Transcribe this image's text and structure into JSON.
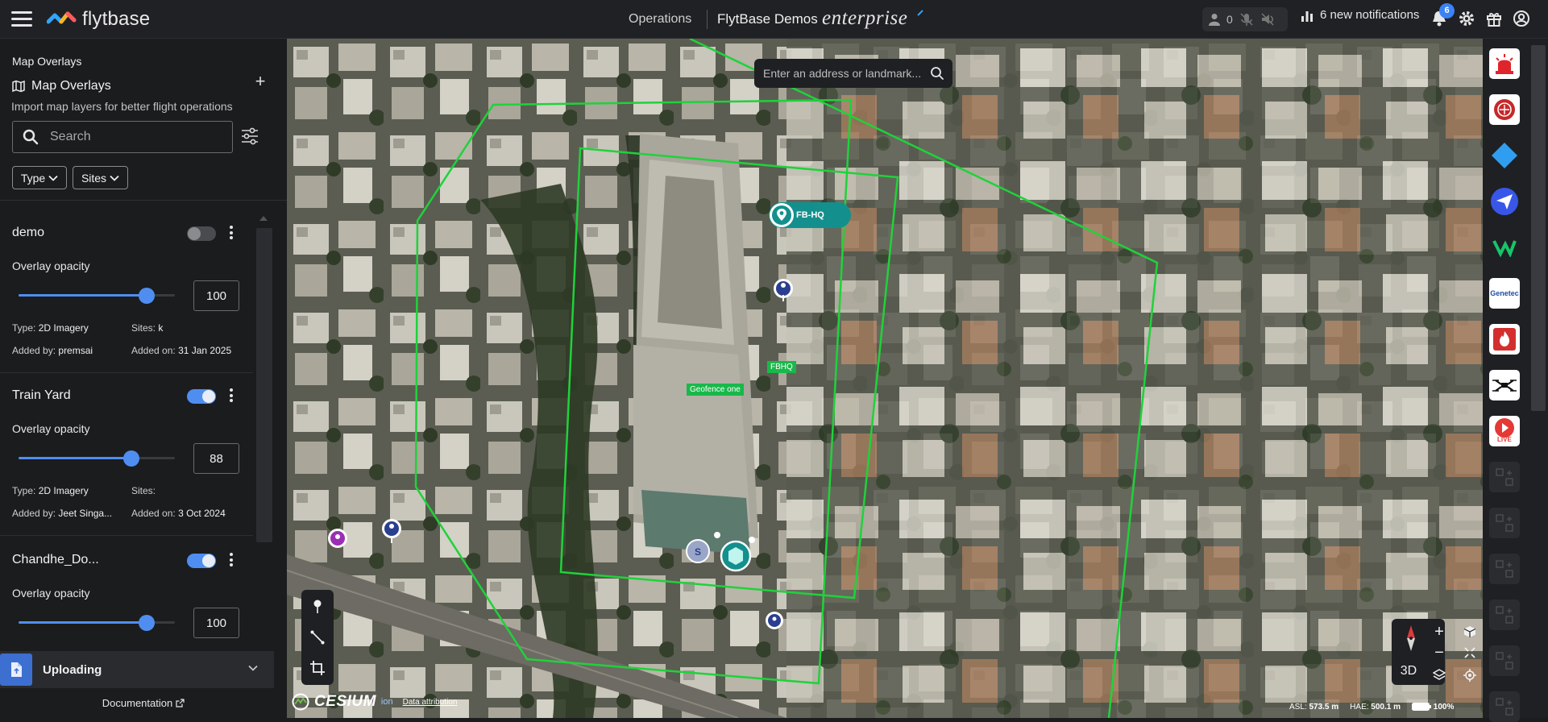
{
  "topbar": {
    "brand": "flytbase",
    "nav_operations": "Operations",
    "org_name": "FlytBase Demos",
    "plan": "enterprise",
    "status_count": "0",
    "notifications": "6 new notifications",
    "bell_badge": "6"
  },
  "panel": {
    "heading": "Map Overlays",
    "title": "Map Overlays",
    "subtitle": "Import map layers for better flight operations",
    "search_placeholder": "Search",
    "filters": [
      "Type",
      "Sites"
    ],
    "overlays": [
      {
        "name": "demo",
        "enabled": false,
        "opacity_label": "Overlay opacity",
        "opacity": 100,
        "type_label": "Type:",
        "type": "2D Imagery",
        "sites_label": "Sites:",
        "sites": "k",
        "added_by_label": "Added by:",
        "added_by": "premsai",
        "added_on_label": "Added on:",
        "added_on": "31 Jan 2025"
      },
      {
        "name": "Train Yard",
        "enabled": true,
        "opacity_label": "Overlay opacity",
        "opacity": 88,
        "type_label": "Type:",
        "type": "2D Imagery",
        "sites_label": "Sites:",
        "sites": "",
        "added_by_label": "Added by:",
        "added_by": "Jeet Singa...",
        "added_on_label": "Added on:",
        "added_on": "3 Oct 2024"
      },
      {
        "name": "Chandhe_Do...",
        "enabled": true,
        "opacity_label": "Overlay opacity",
        "opacity": 100
      }
    ],
    "upload_label": "Uploading",
    "documentation": "Documentation"
  },
  "map": {
    "search_placeholder": "Enter an address or landmark...",
    "labels": {
      "site": "FB-HQ",
      "fbhq": "FBHQ",
      "geofence": "Geofence one"
    },
    "view_mode": "3D",
    "attribution": {
      "brand": "CESIUM",
      "ion": "ion",
      "link": "Data attribution"
    },
    "readout": {
      "asl_label": "ASL:",
      "asl": "573.5 m",
      "hae_label": "HAE:",
      "hae": "500.1 m",
      "battery": "100%"
    }
  },
  "rail": {
    "integrations": [
      "siren",
      "fire-alarm",
      "diamond-app",
      "send-app",
      "va-app",
      "genetec",
      "fire-alert",
      "drone",
      "live"
    ],
    "genetec_label": "Genetec",
    "live_label": "LIVE",
    "empty_slots": 6
  },
  "colors": {
    "accent": "#4f8ef0",
    "geofence": "#1fd23a",
    "teal": "#13908d",
    "panel_bg": "#1b1c1e"
  }
}
